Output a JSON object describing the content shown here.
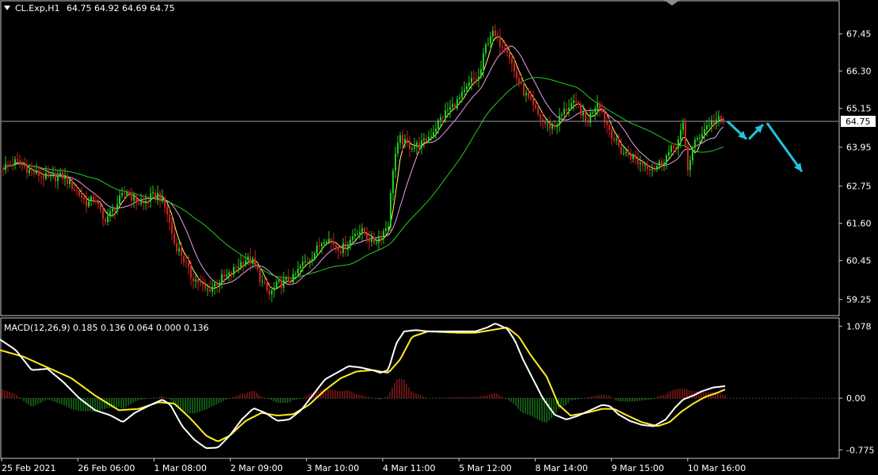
{
  "chart_data": [
    {
      "type": "candlestick",
      "symbol_label": "CL.Exp,H1",
      "ohlc_label": "64.75 64.92 64.69 64.75",
      "last_price": 64.75,
      "last_price_label": "64.75",
      "ylim": [
        58.9,
        68.3
      ],
      "y_ticks": [
        "67.45",
        "66.30",
        "65.15",
        "63.95",
        "62.75",
        "61.60",
        "60.45",
        "59.25"
      ],
      "x_ticks": [
        "25 Feb 2021",
        "26 Feb 06:00",
        "1 Mar 08:00",
        "2 Mar 09:00",
        "3 Mar 10:00",
        "4 Mar 11:00",
        "5 Mar 12:00",
        "8 Mar 14:00",
        "9 Mar 15:00",
        "10 Mar 16:00"
      ],
      "close_path": [
        [
          0,
          63.3
        ],
        [
          20,
          63.5
        ],
        [
          40,
          63.2
        ],
        [
          60,
          63.0
        ],
        [
          80,
          63.05
        ],
        [
          100,
          62.5
        ],
        [
          110,
          62.2
        ],
        [
          120,
          62.4
        ],
        [
          130,
          61.7
        ],
        [
          140,
          61.9
        ],
        [
          150,
          62.3
        ],
        [
          160,
          62.6
        ],
        [
          170,
          62.3
        ],
        [
          180,
          62.2
        ],
        [
          190,
          62.4
        ],
        [
          200,
          62.5
        ],
        [
          210,
          62.0
        ],
        [
          220,
          61.0
        ],
        [
          230,
          60.6
        ],
        [
          240,
          60.0
        ],
        [
          250,
          59.8
        ],
        [
          260,
          59.5
        ],
        [
          270,
          59.7
        ],
        [
          280,
          59.9
        ],
        [
          290,
          60.0
        ],
        [
          300,
          60.3
        ],
        [
          310,
          60.5
        ],
        [
          320,
          60.4
        ],
        [
          330,
          59.8
        ],
        [
          340,
          59.4
        ],
        [
          350,
          59.7
        ],
        [
          360,
          59.8
        ],
        [
          370,
          59.9
        ],
        [
          380,
          60.3
        ],
        [
          390,
          60.5
        ],
        [
          400,
          60.8
        ],
        [
          410,
          61.2
        ],
        [
          420,
          61.0
        ],
        [
          430,
          60.8
        ],
        [
          440,
          61.0
        ],
        [
          450,
          61.4
        ],
        [
          460,
          61.3
        ],
        [
          470,
          61.0
        ],
        [
          480,
          61.2
        ],
        [
          490,
          61.6
        ],
        [
          497,
          63.6
        ],
        [
          505,
          64.2
        ],
        [
          515,
          64.0
        ],
        [
          525,
          64.0
        ],
        [
          535,
          64.1
        ],
        [
          545,
          64.4
        ],
        [
          555,
          64.8
        ],
        [
          565,
          65.1
        ],
        [
          575,
          65.3
        ],
        [
          585,
          65.6
        ],
        [
          595,
          66.0
        ],
        [
          605,
          66.1
        ],
        [
          612,
          67.0
        ],
        [
          620,
          67.5
        ],
        [
          630,
          67.2
        ],
        [
          640,
          67.0
        ],
        [
          650,
          66.2
        ],
        [
          660,
          65.7
        ],
        [
          670,
          65.3
        ],
        [
          680,
          64.9
        ],
        [
          690,
          64.6
        ],
        [
          700,
          64.6
        ],
        [
          710,
          65.0
        ],
        [
          720,
          65.3
        ],
        [
          730,
          65.2
        ],
        [
          740,
          64.7
        ],
        [
          750,
          65.2
        ],
        [
          755,
          65.4
        ],
        [
          765,
          64.7
        ],
        [
          775,
          64.2
        ],
        [
          785,
          63.8
        ],
        [
          795,
          63.7
        ],
        [
          805,
          63.5
        ],
        [
          815,
          63.4
        ],
        [
          825,
          63.3
        ],
        [
          835,
          63.5
        ],
        [
          845,
          63.8
        ],
        [
          855,
          64.1
        ],
        [
          862,
          64.6
        ],
        [
          868,
          63.3
        ],
        [
          875,
          64.0
        ],
        [
          885,
          64.4
        ],
        [
          895,
          64.7
        ],
        [
          905,
          64.8
        ],
        [
          915,
          64.75
        ]
      ],
      "series": [
        {
          "color": "#ffff66",
          "period": 5
        },
        {
          "color": "#e8a0e8",
          "period": 13
        },
        {
          "color": "#22cc22",
          "period": 40
        }
      ],
      "forecast_arrows": [
        {
          "from": [
            918,
            64.75
          ],
          "to": [
            942,
            64.2
          ]
        },
        {
          "from": [
            945,
            64.2
          ],
          "to": [
            963,
            64.65
          ]
        },
        {
          "from": [
            968,
            64.7
          ],
          "to": [
            1012,
            63.2
          ]
        }
      ],
      "colors": {
        "bull": "#22cc22",
        "bear": "#cc2222",
        "arrow": "#22c4dc",
        "price_line": "#9a9aaa",
        "grid_frame": "#c8c8c8"
      }
    },
    {
      "type": "macd",
      "label": "MACD(12,26,9) 0.185 0.136 0.064 0.000 0.136",
      "ylim": [
        -0.83,
        1.13
      ],
      "y_ticks": [
        "1.078",
        "0.00",
        "-0.775"
      ],
      "macd_path": [
        [
          0,
          0.88
        ],
        [
          20,
          0.72
        ],
        [
          40,
          0.42
        ],
        [
          60,
          0.44
        ],
        [
          80,
          0.24
        ],
        [
          100,
          0.0
        ],
        [
          120,
          -0.18
        ],
        [
          140,
          -0.26
        ],
        [
          155,
          -0.36
        ],
        [
          170,
          -0.22
        ],
        [
          190,
          -0.1
        ],
        [
          205,
          -0.02
        ],
        [
          215,
          -0.1
        ],
        [
          230,
          -0.42
        ],
        [
          245,
          -0.62
        ],
        [
          260,
          -0.75
        ],
        [
          275,
          -0.74
        ],
        [
          290,
          -0.56
        ],
        [
          305,
          -0.32
        ],
        [
          320,
          -0.15
        ],
        [
          335,
          -0.22
        ],
        [
          350,
          -0.34
        ],
        [
          365,
          -0.32
        ],
        [
          380,
          -0.18
        ],
        [
          395,
          0.05
        ],
        [
          410,
          0.28
        ],
        [
          425,
          0.38
        ],
        [
          440,
          0.48
        ],
        [
          455,
          0.46
        ],
        [
          470,
          0.42
        ],
        [
          480,
          0.38
        ],
        [
          490,
          0.42
        ],
        [
          500,
          0.82
        ],
        [
          510,
          1.0
        ],
        [
          525,
          1.02
        ],
        [
          540,
          1.0
        ],
        [
          560,
          1.0
        ],
        [
          580,
          1.0
        ],
        [
          600,
          1.0
        ],
        [
          615,
          1.06
        ],
        [
          625,
          1.12
        ],
        [
          640,
          1.04
        ],
        [
          650,
          0.86
        ],
        [
          660,
          0.58
        ],
        [
          672,
          0.3
        ],
        [
          685,
          0.0
        ],
        [
          700,
          -0.25
        ],
        [
          715,
          -0.32
        ],
        [
          730,
          -0.26
        ],
        [
          745,
          -0.18
        ],
        [
          760,
          -0.1
        ],
        [
          770,
          -0.12
        ],
        [
          780,
          -0.24
        ],
        [
          795,
          -0.34
        ],
        [
          810,
          -0.4
        ],
        [
          825,
          -0.42
        ],
        [
          840,
          -0.32
        ],
        [
          852,
          -0.14
        ],
        [
          862,
          -0.02
        ],
        [
          875,
          0.04
        ],
        [
          885,
          0.1
        ],
        [
          900,
          0.16
        ],
        [
          915,
          0.18
        ]
      ],
      "signal_path": [
        [
          0,
          0.72
        ],
        [
          30,
          0.62
        ],
        [
          60,
          0.46
        ],
        [
          90,
          0.3
        ],
        [
          120,
          0.04
        ],
        [
          150,
          -0.18
        ],
        [
          175,
          -0.16
        ],
        [
          200,
          -0.06
        ],
        [
          220,
          -0.08
        ],
        [
          240,
          -0.3
        ],
        [
          260,
          -0.56
        ],
        [
          275,
          -0.65
        ],
        [
          290,
          -0.56
        ],
        [
          310,
          -0.34
        ],
        [
          330,
          -0.22
        ],
        [
          350,
          -0.26
        ],
        [
          370,
          -0.24
        ],
        [
          390,
          -0.1
        ],
        [
          410,
          0.12
        ],
        [
          430,
          0.3
        ],
        [
          450,
          0.4
        ],
        [
          470,
          0.42
        ],
        [
          490,
          0.38
        ],
        [
          505,
          0.58
        ],
        [
          520,
          0.92
        ],
        [
          540,
          1.0
        ],
        [
          560,
          0.99
        ],
        [
          580,
          0.98
        ],
        [
          600,
          0.98
        ],
        [
          620,
          1.02
        ],
        [
          640,
          1.06
        ],
        [
          655,
          0.92
        ],
        [
          670,
          0.64
        ],
        [
          690,
          0.32
        ],
        [
          705,
          -0.1
        ],
        [
          720,
          -0.26
        ],
        [
          740,
          -0.22
        ],
        [
          760,
          -0.16
        ],
        [
          775,
          -0.16
        ],
        [
          790,
          -0.25
        ],
        [
          810,
          -0.36
        ],
        [
          830,
          -0.42
        ],
        [
          845,
          -0.36
        ],
        [
          860,
          -0.2
        ],
        [
          875,
          -0.08
        ],
        [
          890,
          0.02
        ],
        [
          905,
          0.08
        ],
        [
          917,
          0.14
        ]
      ],
      "histogram": {
        "x_start": 3,
        "x_end": 917,
        "step": 3
      },
      "colors": {
        "macd": "#ffffff",
        "signal": "#ffee22",
        "hist_pos": "#cc2222",
        "hist_neg": "#22aa22",
        "zero_line": "#7a7a7a"
      }
    }
  ]
}
